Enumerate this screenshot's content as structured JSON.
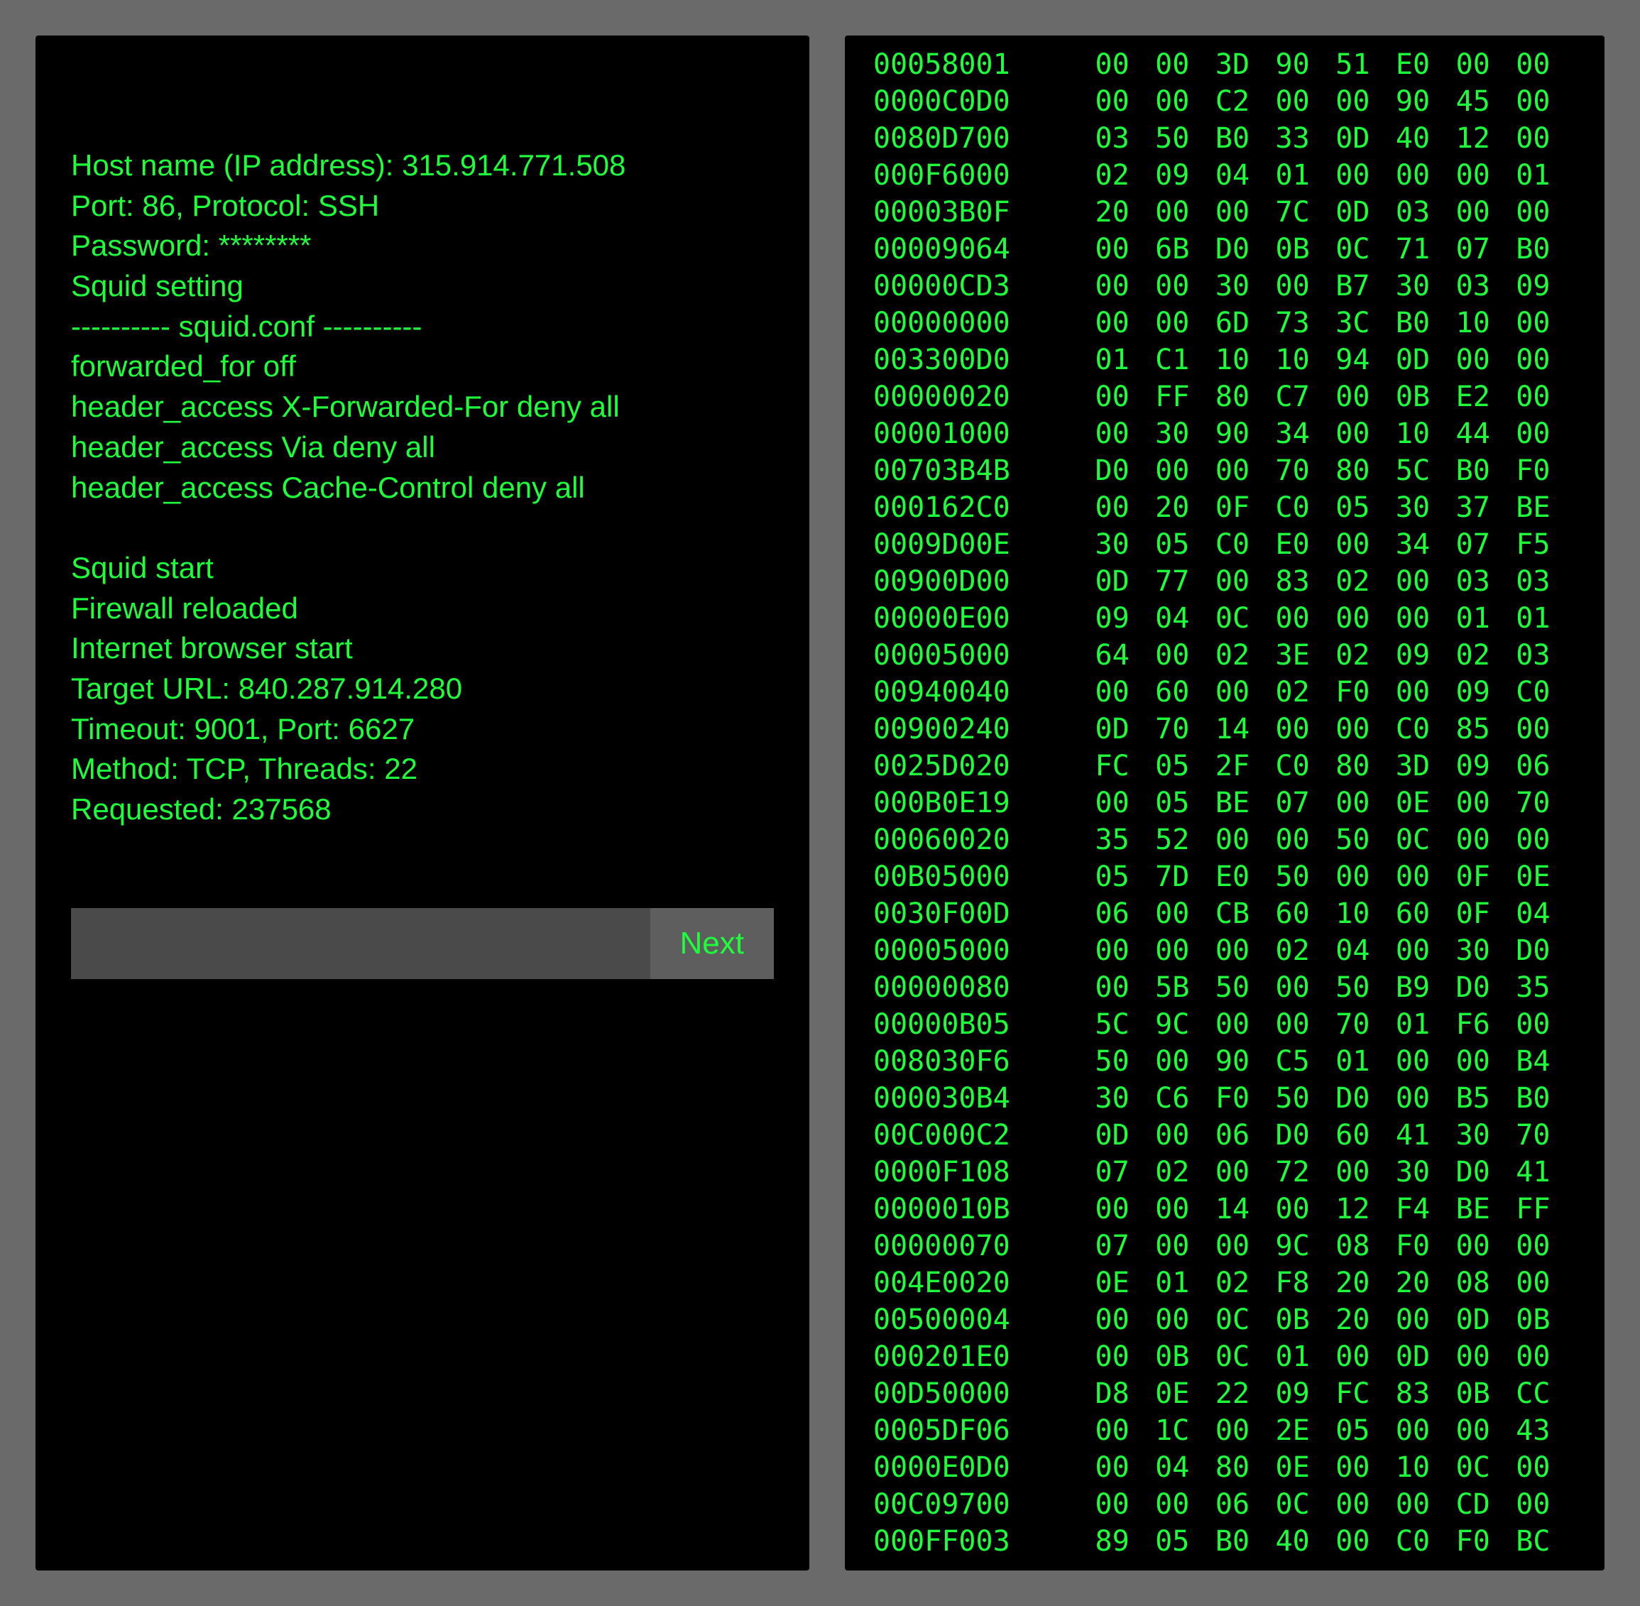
{
  "terminal": {
    "lines": [
      "Host name (IP address): 315.914.771.508",
      "Port: 86, Protocol: SSH",
      "Password: ********",
      "Squid setting",
      "---------- squid.conf ----------",
      "forwarded_for off",
      "header_access X-Forwarded-For deny all",
      "header_access Via deny all",
      "header_access Cache-Control deny all",
      "",
      "Squid start",
      "Firewall reloaded",
      "Internet browser start",
      "Target URL: 840.287.914.280",
      "Timeout: 9001, Port: 6627",
      "Method: TCP, Threads: 22",
      "Requested: 237568"
    ],
    "input_value": "",
    "next_label": "Next"
  },
  "hex": {
    "rows": [
      {
        "addr": "00058001",
        "b": [
          "00",
          "00",
          "3D",
          "90",
          "51",
          "E0",
          "00",
          "00"
        ]
      },
      {
        "addr": "0000C0D0",
        "b": [
          "00",
          "00",
          "C2",
          "00",
          "00",
          "90",
          "45",
          "00"
        ]
      },
      {
        "addr": "0080D700",
        "b": [
          "03",
          "50",
          "B0",
          "33",
          "0D",
          "40",
          "12",
          "00"
        ]
      },
      {
        "addr": "000F6000",
        "b": [
          "02",
          "09",
          "04",
          "01",
          "00",
          "00",
          "00",
          "01"
        ]
      },
      {
        "addr": "00003B0F",
        "b": [
          "20",
          "00",
          "00",
          "7C",
          "0D",
          "03",
          "00",
          "00"
        ]
      },
      {
        "addr": "00009064",
        "b": [
          "00",
          "6B",
          "D0",
          "0B",
          "0C",
          "71",
          "07",
          "B0"
        ]
      },
      {
        "addr": "00000CD3",
        "b": [
          "00",
          "00",
          "30",
          "00",
          "B7",
          "30",
          "03",
          "09"
        ]
      },
      {
        "addr": "00000000",
        "b": [
          "00",
          "00",
          "6D",
          "73",
          "3C",
          "B0",
          "10",
          "00"
        ]
      },
      {
        "addr": "003300D0",
        "b": [
          "01",
          "C1",
          "10",
          "10",
          "94",
          "0D",
          "00",
          "00"
        ]
      },
      {
        "addr": "00000020",
        "b": [
          "00",
          "FF",
          "80",
          "C7",
          "00",
          "0B",
          "E2",
          "00"
        ]
      },
      {
        "addr": "00001000",
        "b": [
          "00",
          "30",
          "90",
          "34",
          "00",
          "10",
          "44",
          "00"
        ]
      },
      {
        "addr": "00703B4B",
        "b": [
          "D0",
          "00",
          "00",
          "70",
          "80",
          "5C",
          "B0",
          "F0"
        ]
      },
      {
        "addr": "000162C0",
        "b": [
          "00",
          "20",
          "0F",
          "C0",
          "05",
          "30",
          "37",
          "BE"
        ]
      },
      {
        "addr": "0009D00E",
        "b": [
          "30",
          "05",
          "C0",
          "E0",
          "00",
          "34",
          "07",
          "F5"
        ]
      },
      {
        "addr": "00900D00",
        "b": [
          "0D",
          "77",
          "00",
          "83",
          "02",
          "00",
          "03",
          "03"
        ]
      },
      {
        "addr": "00000E00",
        "b": [
          "09",
          "04",
          "0C",
          "00",
          "00",
          "00",
          "01",
          "01"
        ]
      },
      {
        "addr": "00005000",
        "b": [
          "64",
          "00",
          "02",
          "3E",
          "02",
          "09",
          "02",
          "03"
        ]
      },
      {
        "addr": "00940040",
        "b": [
          "00",
          "60",
          "00",
          "02",
          "F0",
          "00",
          "09",
          "C0"
        ]
      },
      {
        "addr": "00900240",
        "b": [
          "0D",
          "70",
          "14",
          "00",
          "00",
          "C0",
          "85",
          "00"
        ]
      },
      {
        "addr": "0025D020",
        "b": [
          "FC",
          "05",
          "2F",
          "C0",
          "80",
          "3D",
          "09",
          "06"
        ]
      },
      {
        "addr": "000B0E19",
        "b": [
          "00",
          "05",
          "BE",
          "07",
          "00",
          "0E",
          "00",
          "70"
        ]
      },
      {
        "addr": "00060020",
        "b": [
          "35",
          "52",
          "00",
          "00",
          "50",
          "0C",
          "00",
          "00"
        ]
      },
      {
        "addr": "00B05000",
        "b": [
          "05",
          "7D",
          "E0",
          "50",
          "00",
          "00",
          "0F",
          "0E"
        ]
      },
      {
        "addr": "0030F00D",
        "b": [
          "06",
          "00",
          "CB",
          "60",
          "10",
          "60",
          "0F",
          "04"
        ]
      },
      {
        "addr": "00005000",
        "b": [
          "00",
          "00",
          "00",
          "02",
          "04",
          "00",
          "30",
          "D0"
        ]
      },
      {
        "addr": "00000080",
        "b": [
          "00",
          "5B",
          "50",
          "00",
          "50",
          "B9",
          "D0",
          "35"
        ]
      },
      {
        "addr": "00000B05",
        "b": [
          "5C",
          "9C",
          "00",
          "00",
          "70",
          "01",
          "F6",
          "00"
        ]
      },
      {
        "addr": "008030F6",
        "b": [
          "50",
          "00",
          "90",
          "C5",
          "01",
          "00",
          "00",
          "B4"
        ]
      },
      {
        "addr": "000030B4",
        "b": [
          "30",
          "C6",
          "F0",
          "50",
          "D0",
          "00",
          "B5",
          "B0"
        ]
      },
      {
        "addr": "00C000C2",
        "b": [
          "0D",
          "00",
          "06",
          "D0",
          "60",
          "41",
          "30",
          "70"
        ]
      },
      {
        "addr": "0000F108",
        "b": [
          "07",
          "02",
          "00",
          "72",
          "00",
          "30",
          "D0",
          "41"
        ]
      },
      {
        "addr": "0000010B",
        "b": [
          "00",
          "00",
          "14",
          "00",
          "12",
          "F4",
          "BE",
          "FF"
        ]
      },
      {
        "addr": "00000070",
        "b": [
          "07",
          "00",
          "00",
          "9C",
          "08",
          "F0",
          "00",
          "00"
        ]
      },
      {
        "addr": "004E0020",
        "b": [
          "0E",
          "01",
          "02",
          "F8",
          "20",
          "20",
          "08",
          "00"
        ]
      },
      {
        "addr": "00500004",
        "b": [
          "00",
          "00",
          "0C",
          "0B",
          "20",
          "00",
          "0D",
          "0B"
        ]
      },
      {
        "addr": "000201E0",
        "b": [
          "00",
          "0B",
          "0C",
          "01",
          "00",
          "0D",
          "00",
          "00"
        ]
      },
      {
        "addr": "00D50000",
        "b": [
          "D8",
          "0E",
          "22",
          "09",
          "FC",
          "83",
          "0B",
          "CC"
        ]
      },
      {
        "addr": "0005DF06",
        "b": [
          "00",
          "1C",
          "00",
          "2E",
          "05",
          "00",
          "00",
          "43"
        ]
      },
      {
        "addr": "0000E0D0",
        "b": [
          "00",
          "04",
          "80",
          "0E",
          "00",
          "10",
          "0C",
          "00"
        ]
      },
      {
        "addr": "00C09700",
        "b": [
          "00",
          "00",
          "06",
          "0C",
          "00",
          "00",
          "CD",
          "00"
        ]
      },
      {
        "addr": "000FF003",
        "b": [
          "89",
          "05",
          "B0",
          "40",
          "00",
          "C0",
          "F0",
          "BC"
        ]
      }
    ]
  }
}
